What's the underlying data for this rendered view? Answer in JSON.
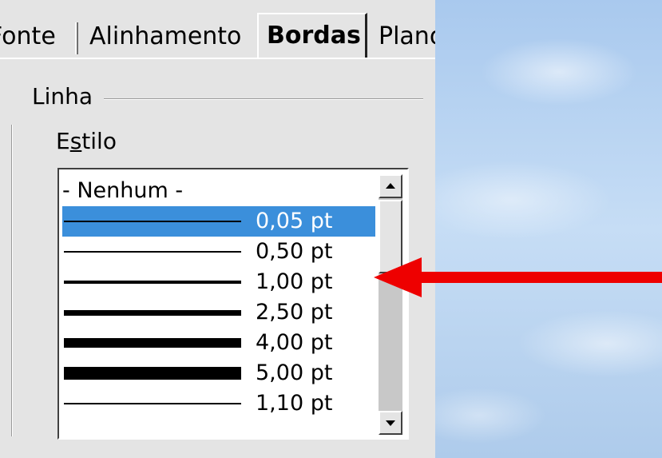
{
  "tabs": [
    {
      "label": "Fonte"
    },
    {
      "label": "Alinhamento"
    },
    {
      "label": "Bordas",
      "active": true
    },
    {
      "label": "Plano de fundo"
    }
  ],
  "line_section": {
    "label": "Linha"
  },
  "style_label": {
    "prefix": "E",
    "accel": "s",
    "rest": "tilo"
  },
  "style_list": {
    "none_label": "- Nenhum -",
    "items": [
      {
        "value": "0,05 pt",
        "selected": true
      },
      {
        "value": "0,50 pt"
      },
      {
        "value": "1,00 pt"
      },
      {
        "value": "2,50 pt"
      },
      {
        "value": "4,00 pt"
      },
      {
        "value": "5,00 pt"
      },
      {
        "value": "1,10 pt"
      }
    ]
  },
  "colors": {
    "selection": "#3b8fdb",
    "arrow": "#ee0000"
  },
  "icons": [
    "scroll-up-icon",
    "scroll-down-icon",
    "pointer-arrow-icon"
  ]
}
